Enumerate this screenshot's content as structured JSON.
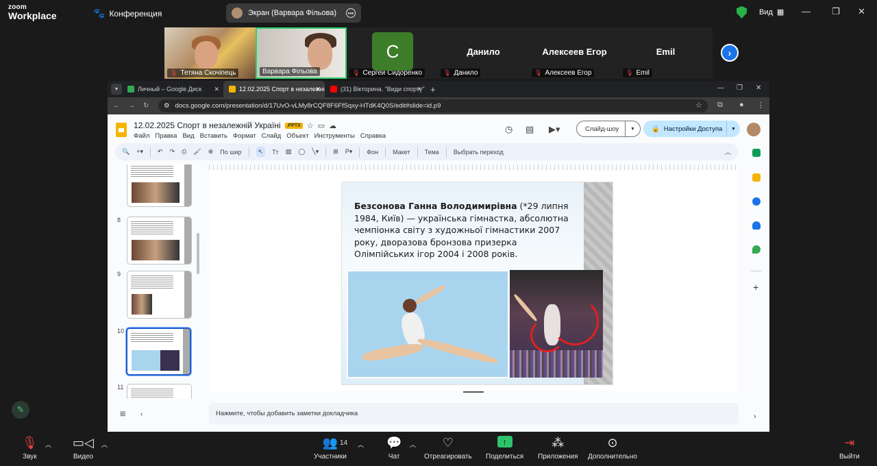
{
  "zoom": {
    "logo_line1": "zoom",
    "logo_line2": "Workplace",
    "meeting_label": "Конференция",
    "screen_share_label": "Экран (Варвара Фільова)",
    "view_label": "Вид",
    "participants": [
      {
        "name": "Тетяна Скочіпець",
        "muted": true
      },
      {
        "name": "Варвара Фільова",
        "muted": false,
        "active": true
      },
      {
        "name": "Сергей Сидоренко",
        "muted": true,
        "avatar_letter": "C"
      },
      {
        "name": "Данило",
        "muted": true,
        "big_name": "Данило"
      },
      {
        "name": "Алексеев Егор",
        "muted": true,
        "big_name": "Алексеев Егор"
      },
      {
        "name": "Emil",
        "muted": true,
        "big_name": "Emil"
      }
    ],
    "toolbar": {
      "audio": "Звук",
      "video": "Видео",
      "participants": "Участники",
      "participants_count": "14",
      "chat": "Чат",
      "react": "Отреагировать",
      "share": "Поделиться",
      "apps": "Приложения",
      "more": "Дополнительно",
      "leave": "Выйти"
    }
  },
  "browser": {
    "tabs": [
      {
        "title": "Личный – Google Диск",
        "color": "#34a853"
      },
      {
        "title": "12.02.2025 Спорт в незалежній",
        "color": "#f4b400",
        "active": true
      },
      {
        "title": "(31) Вікторина. \"Види спорту\"",
        "color": "#ff0000"
      }
    ],
    "url": "docs.google.com/presentation/d/17UvO-vLMy8rCQF8F6FfSqxy-HTdK4Q0S/edit#slide=id.p9"
  },
  "slides": {
    "doc_title": "12.02.2025  Спорт в незалежній Україні",
    "badge": ".PPTX",
    "menu": [
      "Файл",
      "Правка",
      "Вид",
      "Вставить",
      "Формат",
      "Слайд",
      "Объект",
      "Инструменты",
      "Справка"
    ],
    "slideshow_label": "Слайд-шоу",
    "share_label": "Настройки Доступа",
    "toolbar": {
      "zoom_label": "По шир",
      "background": "Фон",
      "layout": "Макет",
      "theme": "Тема",
      "transition": "Выбрать переход"
    },
    "thumbnails": [
      {
        "num": ""
      },
      {
        "num": "8"
      },
      {
        "num": "9"
      },
      {
        "num": "10",
        "selected": true
      },
      {
        "num": "11"
      }
    ],
    "slide": {
      "name_bold": "Безсонова Ганна Володимирівна",
      "text_rest": " (*29 липня 1984, Київ) — українська гімнастка, абсолютна чемпіонка світу з художньої гімнастики 2007 року, дворазова бронзова призерка Олімпійських ігор 2004 і 2008 років."
    },
    "notes_placeholder": "Нажмите, чтобы добавить заметки докладчика"
  }
}
